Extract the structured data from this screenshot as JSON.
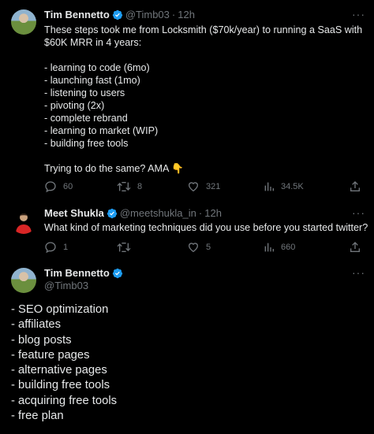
{
  "tweet1": {
    "author_name": "Tim Bennetto",
    "handle": "@Timb03",
    "separator": "·",
    "time": "12h",
    "more": "···",
    "text": "These steps took me from Locksmith ($70k/year) to running a SaaS with\n$60K MRR in 4 years:\n\n- learning to code (6mo)\n- launching fast (1mo)\n- listening to users\n- pivoting (2x)\n- complete rebrand\n- learning to market (WIP)\n- building free tools\n\nTrying to do the same? AMA 👇",
    "replies": "60",
    "retweets": "8",
    "likes": "321",
    "views": "34.5K"
  },
  "tweet2": {
    "author_name": "Meet Shukla",
    "handle": "@meetshukla_in",
    "separator": "·",
    "time": "12h",
    "more": "···",
    "text": "What kind of marketing techniques did you use before you started twitter?",
    "replies": "1",
    "retweets": "",
    "likes": "5",
    "views": "660"
  },
  "tweet3": {
    "author_name": "Tim Bennetto",
    "handle": "@Timb03",
    "more": "···",
    "text": "- SEO optimization\n- affiliates\n- blog posts\n- feature pages\n- alternative pages\n- building free tools\n- acquiring free tools\n- free plan"
  },
  "colors": {
    "background": "#000000",
    "text": "#e7e9ea",
    "muted": "#71767b",
    "verified": "#1d9bf0"
  },
  "icons": [
    "reply-icon",
    "retweet-icon",
    "like-icon",
    "views-icon",
    "share-icon",
    "verified-icon",
    "more-icon"
  ]
}
